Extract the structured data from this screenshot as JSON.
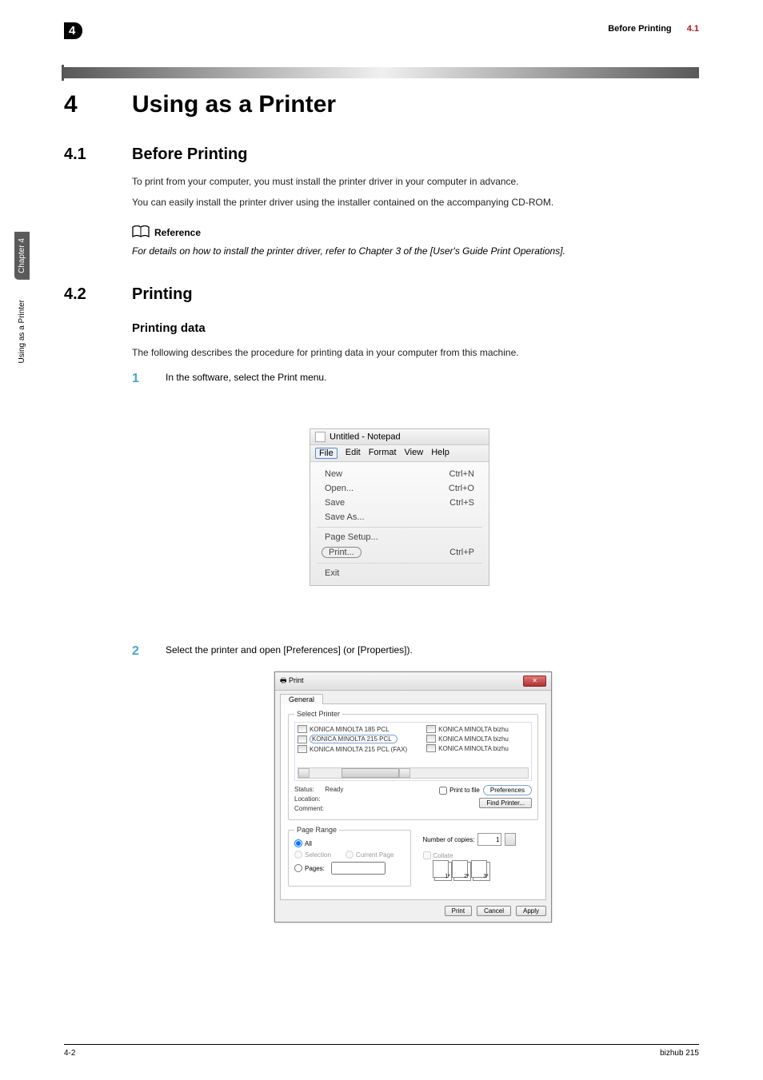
{
  "header": {
    "chapter_badge": "4",
    "right_label": "Before Printing",
    "right_sec": "4.1"
  },
  "side_tab": "Chapter 4",
  "side_text": "Using as a Printer",
  "h4": {
    "num": "4",
    "title": "Using as a Printer"
  },
  "s41": {
    "num": "4.1",
    "title": "Before Printing",
    "p1": "To print from your computer, you must install the printer driver in your computer in advance.",
    "p2": "You can easily install the printer driver using the installer contained on the accompanying CD-ROM.",
    "ref_label": "Reference",
    "ref_text": "For details on how to install the printer driver, refer to Chapter 3 of the [User's Guide Print Operations]."
  },
  "s42": {
    "num": "4.2",
    "title": "Printing",
    "sub": "Printing data",
    "intro": "The following describes the procedure for printing data in your computer from this machine.",
    "step1": "In the software, select the Print menu.",
    "step2": "Select the printer and open [Preferences] (or [Properties])."
  },
  "notepad": {
    "title": "Untitled - Notepad",
    "menus": [
      "File",
      "Edit",
      "Format",
      "View",
      "Help"
    ],
    "items": [
      {
        "l": "New",
        "r": "Ctrl+N"
      },
      {
        "l": "Open...",
        "r": "Ctrl+O"
      },
      {
        "l": "Save",
        "r": "Ctrl+S"
      },
      {
        "l": "Save As...",
        "r": ""
      }
    ],
    "page_setup": "Page Setup...",
    "print": {
      "l": "Print...",
      "r": "Ctrl+P"
    },
    "exit": "Exit"
  },
  "printdlg": {
    "title": "Print",
    "tab": "General",
    "select_printer": "Select Printer",
    "printers_left": [
      "KONICA MINOLTA 185 PCL",
      "KONICA MINOLTA 215 PCL",
      "KONICA MINOLTA 215 PCL (FAX)"
    ],
    "printers_right": [
      "KONICA MINOLTA bizhu",
      "KONICA MINOLTA bizhu",
      "KONICA MINOLTA bizhu"
    ],
    "status_label": "Status:",
    "status_value": "Ready",
    "location_label": "Location:",
    "comment_label": "Comment:",
    "print_to_file": "Print to file",
    "preferences": "Preferences",
    "find_printer": "Find Printer...",
    "page_range": "Page Range",
    "all": "All",
    "selection": "Selection",
    "current_page": "Current Page",
    "pages": "Pages:",
    "num_copies_label": "Number of copies:",
    "num_copies_value": "1",
    "collate": "Collate",
    "collate_nums": [
      "1¹",
      "2²",
      "3³"
    ],
    "btn_print": "Print",
    "btn_cancel": "Cancel",
    "btn_apply": "Apply"
  },
  "footer": {
    "left": "4-2",
    "right": "bizhub 215"
  }
}
